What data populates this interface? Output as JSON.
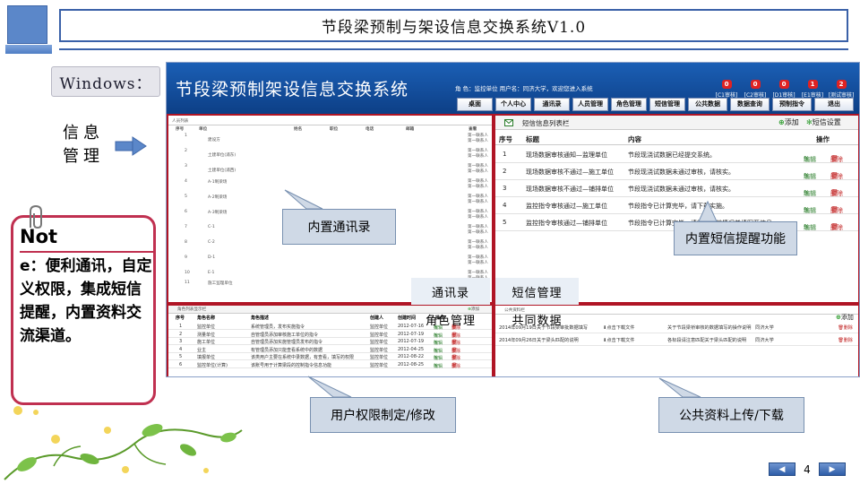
{
  "slide": {
    "title": "节段梁预制与架设信息交换系统V1.0",
    "windows_label": "Windows：",
    "info_label_1": "信息",
    "info_label_2": "管理",
    "note_title": "Not",
    "note_body": "e：便利通讯，自定义权限，集成短信提醒，内置资料交流渠道。",
    "page_number": "4",
    "prev_icon": "triangle-left",
    "next_icon": "triangle-right"
  },
  "app": {
    "title": "节段梁预制架设信息交换系统",
    "user_info": "角 色：监控单位   用户名：同济大学，欢迎您进入系统",
    "badges": [
      {
        "count": "0",
        "label": "[C1审核]"
      },
      {
        "count": "0",
        "label": "[C2审核]"
      },
      {
        "count": "0",
        "label": "[D1审核]"
      },
      {
        "count": "1",
        "label": "[E1审核]"
      },
      {
        "count": "2",
        "label": "[测试审核]"
      }
    ],
    "nav": [
      "桌面",
      "个人中心",
      "通讯录",
      "人员管理",
      "角色管理",
      "短信管理",
      "公共数据",
      "数据查询",
      "预制指令",
      "退出"
    ],
    "contacts": {
      "header": "人员列表",
      "cols": [
        "序号",
        "单位",
        "姓名",
        "职位",
        "电话",
        "邮箱",
        "查看"
      ],
      "rows": [
        {
          "no": "1",
          "unit": "建设方"
        },
        {
          "no": "2",
          "unit": "土建单位(浦东)"
        },
        {
          "no": "3",
          "unit": "土建单位(浦西)"
        },
        {
          "no": "4",
          "unit": "A-1制梁场"
        },
        {
          "no": "5",
          "unit": "A-2制梁场"
        },
        {
          "no": "6",
          "unit": "A-3制梁场"
        },
        {
          "no": "7",
          "unit": "C-1"
        },
        {
          "no": "8",
          "unit": "C-2"
        },
        {
          "no": "9",
          "unit": "D-1"
        },
        {
          "no": "10",
          "unit": "E-1"
        },
        {
          "no": "11",
          "unit": "施工监理单位"
        }
      ],
      "side_text": "第一联系人"
    },
    "sms": {
      "header": "短信信息列表栏",
      "add_label": "添加",
      "settings_label": "短信设置",
      "cols": [
        "序号",
        "标题",
        "内容",
        "操作"
      ],
      "edit_label": "编辑",
      "delete_label": "删除",
      "rows": [
        {
          "no": "1",
          "title": "现场数据审核通知—监理单位",
          "content": "节段现浇试数据已经提交系统。"
        },
        {
          "no": "2",
          "title": "现场数据审核不通过—施工单位",
          "content": "节段现浇试数据未通过审核，请核实。"
        },
        {
          "no": "3",
          "title": "现场数据审核不通过—铺排单位",
          "content": "节段现浇试数据未通过审核，请核实。"
        },
        {
          "no": "4",
          "title": "监控指令审核通过—施工单位",
          "content": "节段指令已计算完毕，请下载实施。"
        },
        {
          "no": "5",
          "title": "监控指令审核通过—铺排单位",
          "content": "节段指令已计算完毕，请将施工前情况并填写至信息。"
        }
      ]
    },
    "roles": {
      "header": "角色列表显示栏",
      "add_label": "添加",
      "cols": [
        "序号",
        "角色名称",
        "角色描述",
        "创建人",
        "创建时间",
        "操作"
      ],
      "edit_label": "编辑",
      "delete_label": "删除",
      "rows": [
        {
          "no": "1",
          "name": "监控单位",
          "desc": "系统管理员，发布实施指令",
          "creator": "监控单位",
          "date": "2012-07-16"
        },
        {
          "no": "2",
          "name": "测量单位",
          "desc": "自管理员添加审核施工单位的指令",
          "creator": "监控单位",
          "date": "2012-07-19"
        },
        {
          "no": "3",
          "name": "施工单位",
          "desc": "自管理员添加实施管理员发布的指令",
          "creator": "监控单位",
          "date": "2012-07-19"
        },
        {
          "no": "4",
          "name": "业主",
          "desc": "有管理员添加只能查看系统中的数据",
          "creator": "监控单位",
          "date": "2012-04-25"
        },
        {
          "no": "5",
          "name": "填报单位",
          "desc": "该类用户主要在系统中录数据，有查看，填写的权限",
          "creator": "监控单位",
          "date": "2012-08-22"
        },
        {
          "no": "6",
          "name": "监控单位(计算)",
          "desc": "该账号用于计算梁段的控制指令信息功能",
          "creator": "监控单位",
          "date": "2012-08-25"
        }
      ]
    },
    "public": {
      "header": "公共资料栏",
      "add_label": "添加",
      "download_label": "点击下载文件",
      "delete_label": "删除",
      "rows": [
        {
          "date": "2014年09月19日",
          "title": "关于节段梁审批数据填写",
          "desc": "关于节段梁桥审核的数据填写的操作说明",
          "org": "同济大学"
        },
        {
          "date": "2014年09月26日",
          "title": "关于梁头匹配的说明",
          "desc": "各标段请注意匹配关于梁头匹配的说明",
          "org": "同济大学"
        }
      ]
    }
  },
  "callouts": {
    "contacts": "内置通讯录",
    "sms": "内置短信提醒功能",
    "roles": "用户权限制定/修改",
    "public": "公共资料上传/下载"
  },
  "mini_labels": [
    "通讯录",
    "短信管理",
    "角色管理",
    "共同数据"
  ],
  "colors": {
    "accent": "#3a61a8",
    "app_header": "#1b5fb5",
    "pane_border": "#b01525",
    "note_border": "#c03050",
    "callout_fill": "#cfd9e6"
  }
}
